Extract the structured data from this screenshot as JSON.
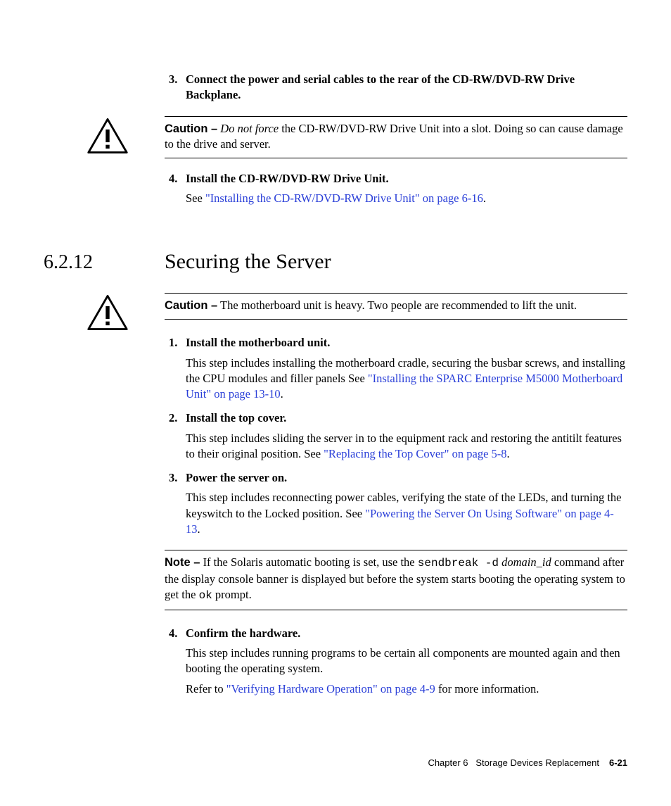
{
  "top": {
    "step3": {
      "num": "3.",
      "text": "Connect the power and serial cables to the rear of the CD-RW/DVD-RW Drive Backplane."
    },
    "caution": {
      "label": "Caution –",
      "lead_italic": "Do not force",
      "rest": " the CD-RW/DVD-RW Drive Unit into a slot. Doing so can cause damage to the drive and server."
    },
    "step4": {
      "num": "4.",
      "text": "Install the CD-RW/DVD-RW Drive Unit.",
      "body_prefix": "See ",
      "body_link": "\"Installing the CD-RW/DVD-RW Drive Unit\" on page 6-16",
      "body_suffix": "."
    }
  },
  "section": {
    "num": "6.2.12",
    "title": "Securing the Server"
  },
  "caution2": {
    "label": "Caution –",
    "text": " The motherboard unit is heavy. Two people are recommended to lift the unit."
  },
  "steps": {
    "s1": {
      "num": "1.",
      "title": "Install the motherboard unit.",
      "body_a": "This step includes installing the motherboard cradle, securing the busbar screws, and installing the CPU modules and filler panels See ",
      "link": "\"Installing the SPARC Enterprise M5000 Motherboard Unit\" on page 13-10",
      "body_b": "."
    },
    "s2": {
      "num": "2.",
      "title": "Install the top cover.",
      "body_a": "This step includes sliding the server in to the equipment rack and restoring the antitilt features to their original position. See ",
      "link": "\"Replacing the Top Cover\" on page 5-8",
      "body_b": "."
    },
    "s3": {
      "num": "3.",
      "title": "Power the server on.",
      "body_a": "This step includes reconnecting power cables, verifying the state of the LEDs, and turning the keyswitch to the Locked position. See ",
      "link": "\"Powering the Server On Using Software\" on page 4-13",
      "body_b": "."
    },
    "s4": {
      "num": "4.",
      "title": "Confirm the hardware.",
      "body_a": "This step includes running programs to be certain all components are mounted again and then booting the operating system.",
      "body_b_prefix": "Refer to ",
      "link": "\"Verifying Hardware Operation\" on page 4-9",
      "body_b_suffix": " for more information."
    }
  },
  "note": {
    "label": "Note –",
    "t1": " If the Solaris automatic booting is set, use the ",
    "code1": "sendbreak -d",
    "t2": " ",
    "domain_id": "domain_id",
    "t3": " command after the display console banner is displayed but before the system starts booting the operating system to get the ",
    "code2": "ok",
    "t4": " prompt."
  },
  "footer": {
    "chapter": "Chapter 6",
    "title": "Storage Devices Replacement",
    "page": "6-21"
  }
}
